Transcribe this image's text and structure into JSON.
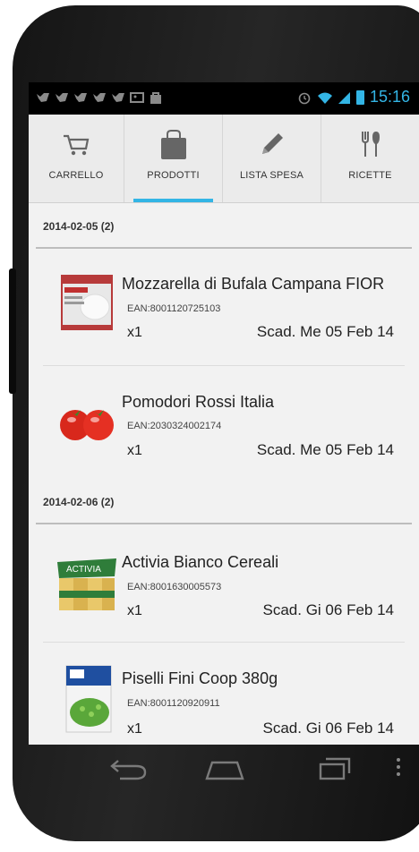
{
  "status_bar": {
    "time": "15:16",
    "notification_icons": [
      "twitter-icon",
      "twitter-icon",
      "twitter-icon",
      "twitter-icon",
      "twitter-icon",
      "image-icon",
      "bag-icon"
    ]
  },
  "tabs": [
    {
      "label": "CARRELLO",
      "icon": "cart-icon",
      "active": false
    },
    {
      "label": "PRODOTTI",
      "icon": "bag-icon",
      "active": true
    },
    {
      "label": "LISTA SPESA",
      "icon": "pencil-icon",
      "active": false
    },
    {
      "label": "RICETTE",
      "icon": "fork-knife-icon",
      "active": false
    }
  ],
  "sections": [
    {
      "header": "2014-02-05 (2)",
      "items": [
        {
          "name": "Mozzarella di Bufala Campana FIOR",
          "ean": "EAN:8001120725103",
          "qty": "x1",
          "expiry": "Scad. Me 05 Feb 14",
          "image": "mozzarella-box"
        },
        {
          "name": "Pomodori Rossi Italia",
          "ean": "EAN:2030324002174",
          "qty": "x1",
          "expiry": "Scad. Me 05 Feb 14",
          "image": "tomatoes"
        }
      ]
    },
    {
      "header": "2014-02-06 (2)",
      "items": [
        {
          "name": "Activia Bianco Cereali",
          "ean": "EAN:8001630005573",
          "qty": "x1",
          "expiry": "Scad. Gi 06 Feb 14",
          "image": "yogurt-pack"
        },
        {
          "name": "Piselli Fini Coop 380g",
          "ean": "EAN:8001120920911",
          "qty": "x1",
          "expiry": "Scad. Gi 06 Feb 14",
          "image": "peas-box"
        }
      ]
    }
  ],
  "colors": {
    "accent": "#33b5e5",
    "tab_bg": "#ebebeb",
    "list_bg": "#f2f2f2"
  }
}
